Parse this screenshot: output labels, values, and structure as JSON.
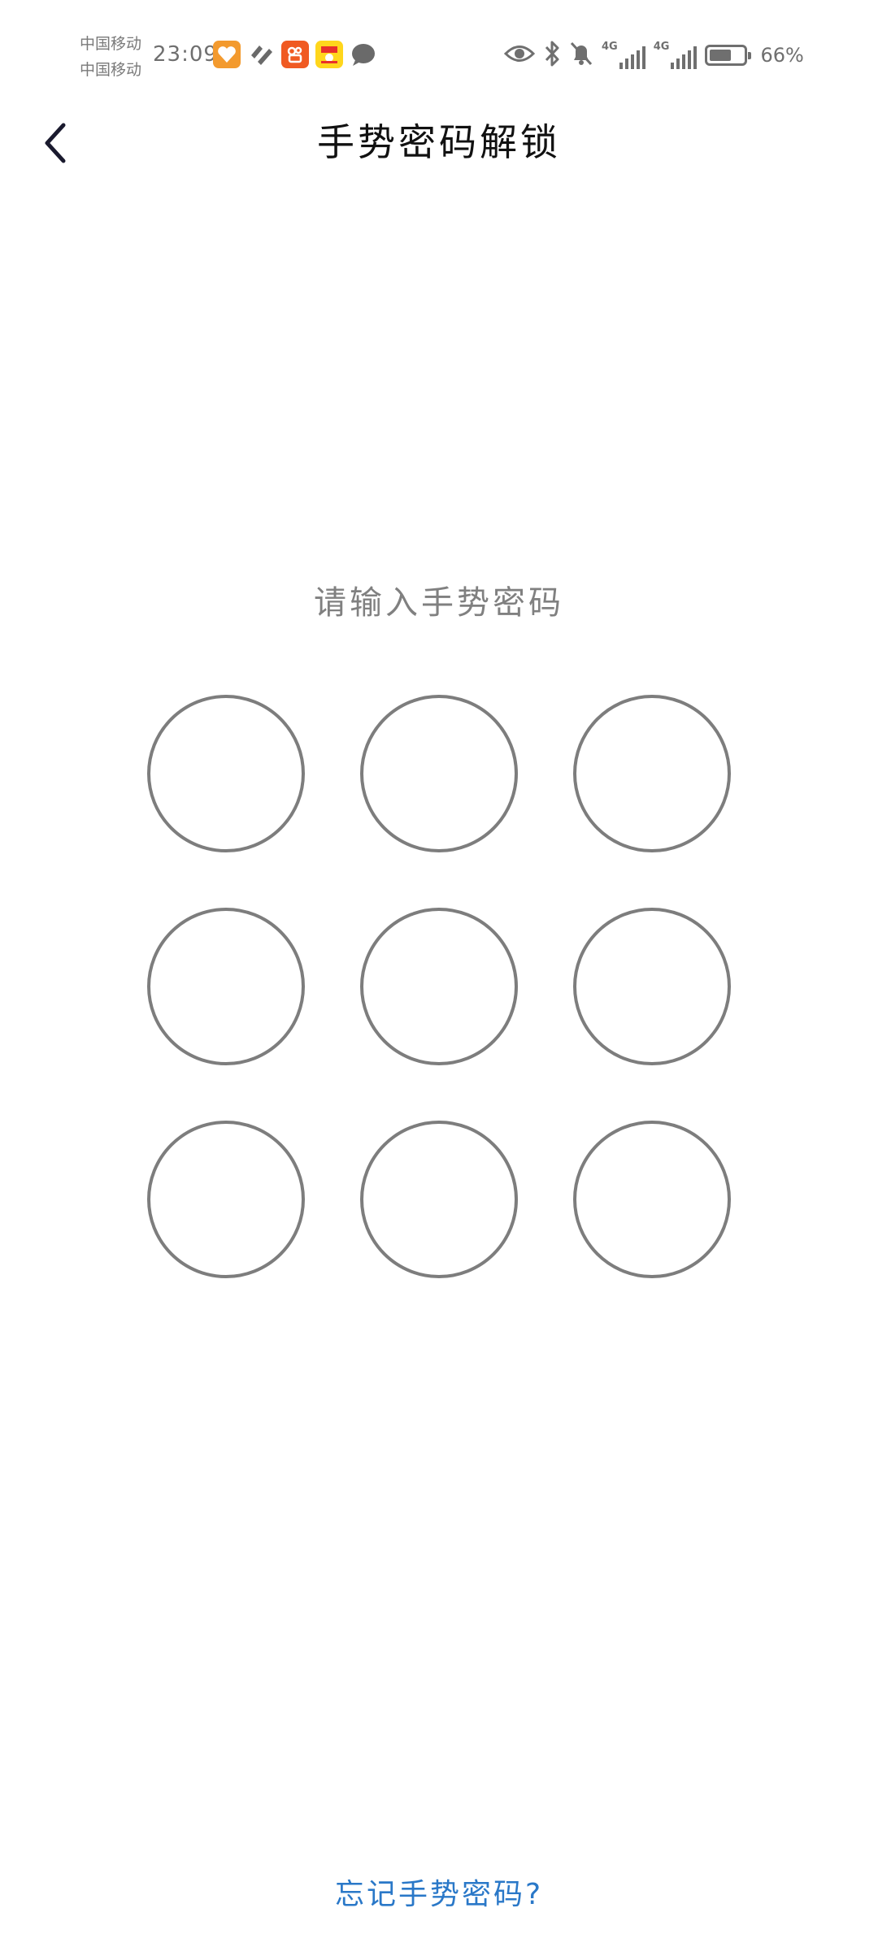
{
  "status_bar": {
    "carrier_1": "中国移动",
    "carrier_2": "中国移动",
    "time": "23:09",
    "notification_icons": [
      "orange-heart-app-icon",
      "health-app-icon",
      "kuaishou-app-icon",
      "yellow-app-icon",
      "message-bubble-icon"
    ],
    "system_icons": [
      "eye-icon",
      "bluetooth-icon",
      "mute-bell-icon"
    ],
    "network_1_label": "4G",
    "network_2_label": "4G",
    "battery_level": 0.66,
    "battery_text": "66%",
    "colors": {
      "text": "#6f6f6f"
    }
  },
  "header": {
    "back_icon": "chevron-left-icon",
    "title": "手势密码解锁"
  },
  "main": {
    "prompt": "请输入手势密码",
    "pattern_dots": [
      1,
      2,
      3,
      4,
      5,
      6,
      7,
      8,
      9
    ],
    "dot_border_color": "#7d7d7d"
  },
  "footer": {
    "forgot_link": "忘记手势密码?",
    "link_color": "#2a78c8"
  }
}
